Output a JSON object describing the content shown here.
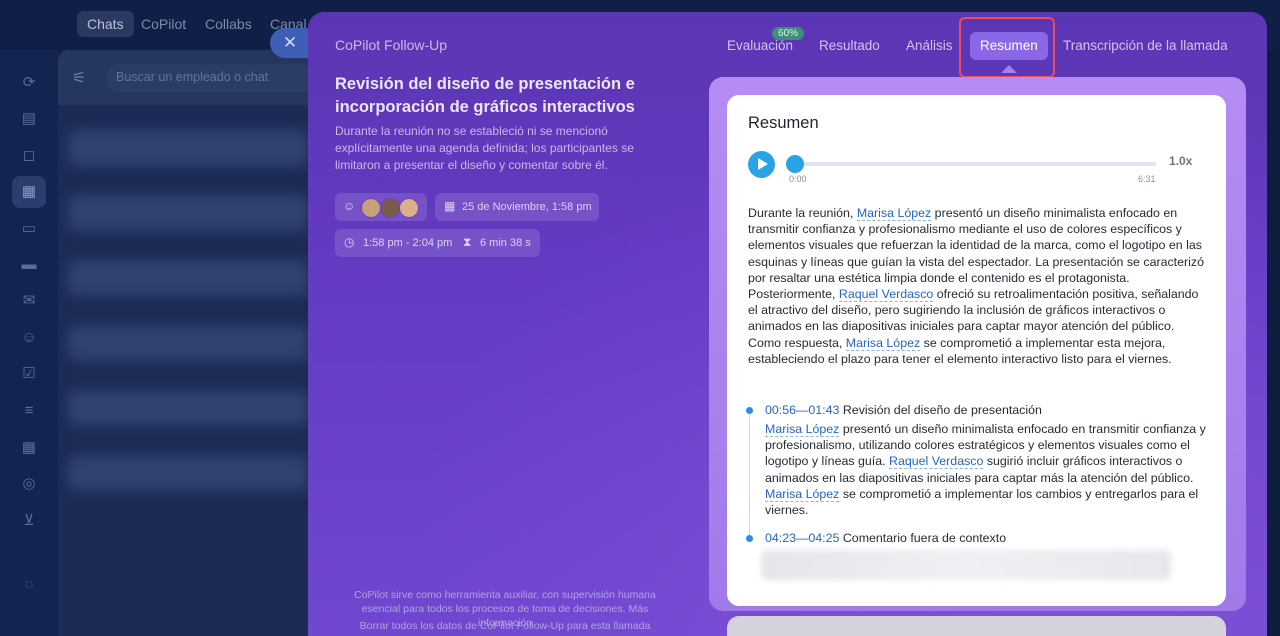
{
  "background": {
    "top_tabs": [
      "Chats",
      "CoPilot",
      "Collabs",
      "Canal"
    ],
    "search_placeholder": "Buscar un empleado o chat"
  },
  "panel": {
    "title": "CoPilot Follow-Up",
    "tabs": [
      {
        "label": "Evaluación"
      },
      {
        "label": "Resultado"
      },
      {
        "label": "Análisis"
      },
      {
        "label": "Resumen"
      },
      {
        "label": "Transcripción de la llamada"
      }
    ],
    "evaluation_score": "60%",
    "meeting_title": "Revisión del diseño de presentación e incorporación de gráficos interactivos",
    "meeting_description": "Durante la reunión no se estableció ni se mencionó explícitamente una agenda definida; los participantes se limitaron a presentar el diseño y comentar sobre él.",
    "date": "25 de Noviembre, 1:58 pm",
    "time_range": "1:58 pm - 2:04 pm",
    "duration": "6 min 38 s",
    "footer_note": "CoPilot sirve como herramienta auxiliar, con supervisión humana esencial para todos los procesos de toma de decisiones. Más información",
    "footer_link": "Borrar todos los datos de CoPilot Follow-Up para esta llamada"
  },
  "summary": {
    "heading": "Resumen",
    "player": {
      "current": "0:00",
      "total": "6:31",
      "speed": "1.0x",
      "progress": 0
    },
    "text": {
      "p1": "Durante la reunión, ",
      "m1": "Marisa López",
      "p2": " presentó un diseño minimalista enfocado en transmitir confianza y profesionalismo mediante el uso de colores específicos y elementos visuales que refuerzan la identidad de la marca, como el logotipo en las esquinas y líneas que guían la vista del espectador. La presentación se caracterizó por resaltar una estética limpia donde el contenido es el protagonista. Posteriormente, ",
      "m2": "Raquel Verdasco",
      "p3": " ofreció su retroalimentación positiva, señalando el atractivo del diseño, pero sugiriendo la inclusión de gráficos interactivos o animados en las diapositivas iniciales para captar mayor atención del público. Como respuesta, ",
      "m3": "Marisa López",
      "p4": " se comprometió a implementar esta mejora, estableciendo el plazo para tener el elemento interactivo listo para el viernes."
    },
    "timeline": [
      {
        "time": "00:56—01:43",
        "title": " Revisión del diseño de presentación",
        "m1": "Marisa López",
        "p1": " presentó un diseño minimalista enfocado en transmitir confianza y profesionalismo, utilizando colores estratégicos y elementos visuales como el logotipo y líneas guía. ",
        "m2": "Raquel Verdasco",
        "p2": " sugirió incluir gráficos interactivos o animados en las diapositivas iniciales para captar más la atención del público. ",
        "m3": "Marisa López",
        "p3": " se comprometió a implementar los cambios y entregarlos para el viernes."
      },
      {
        "time": "04:23—04:25",
        "title": " Comentario fuera de contexto"
      }
    ]
  }
}
